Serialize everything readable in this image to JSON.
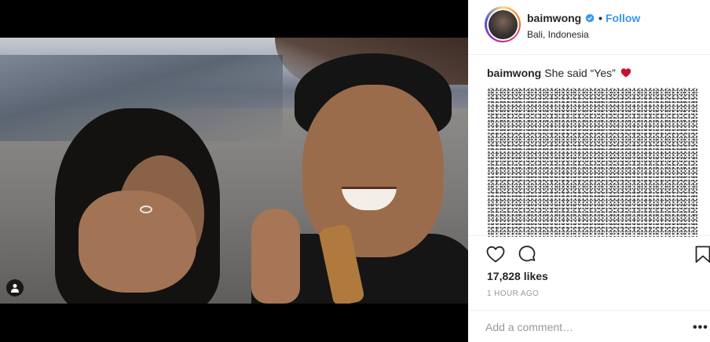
{
  "post": {
    "username": "baimwong",
    "verified_icon": "verified-badge-icon",
    "separator": "•",
    "follow_label": "Follow",
    "location": "Bali, Indonesia",
    "caption_username": "baimwong",
    "caption_text": "She said “Yes”",
    "caption_emoji": "red-heart-icon",
    "likes": "17,828 likes",
    "timestamp": "1 HOUR AGO",
    "comment_placeholder": "Add a comment…",
    "more_label": "•••"
  },
  "colors": {
    "accent": "#3897f0",
    "text": "#262626",
    "muted": "#999999",
    "border": "#efefef",
    "heart": "#ed4956"
  },
  "icons": {
    "like": "heart-outline-icon",
    "comment": "comment-bubble-icon",
    "save": "bookmark-icon",
    "tagged": "user-tag-icon"
  }
}
